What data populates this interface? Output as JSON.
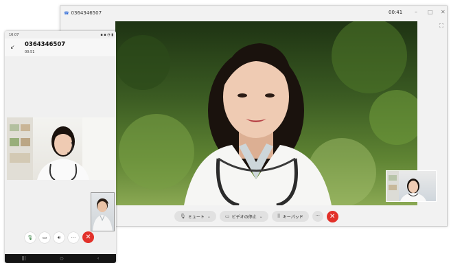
{
  "desktop": {
    "title_number": "0364346507",
    "timer": "00:41",
    "window_controls": [
      "minimize-icon",
      "maximize-icon",
      "close-icon"
    ],
    "toolbar": {
      "mute_label": "ミュート",
      "video_stop_label": "ビデオの停止",
      "keypad_label": "キーパッド",
      "more_label": "···",
      "end_call": "end-call-icon"
    }
  },
  "phone": {
    "status_time": "16:07",
    "caller_number": "0364346507",
    "call_duration": "00:51",
    "controls": [
      "mic-icon",
      "video-icon",
      "speaker-icon",
      "more-icon",
      "end-call-icon"
    ],
    "nav": [
      "recent-apps-icon",
      "home-icon",
      "back-icon"
    ]
  },
  "colors": {
    "end_call": "#e2312a",
    "accent_blue": "#2f6bd8",
    "mic_green": "#2a7a38"
  }
}
